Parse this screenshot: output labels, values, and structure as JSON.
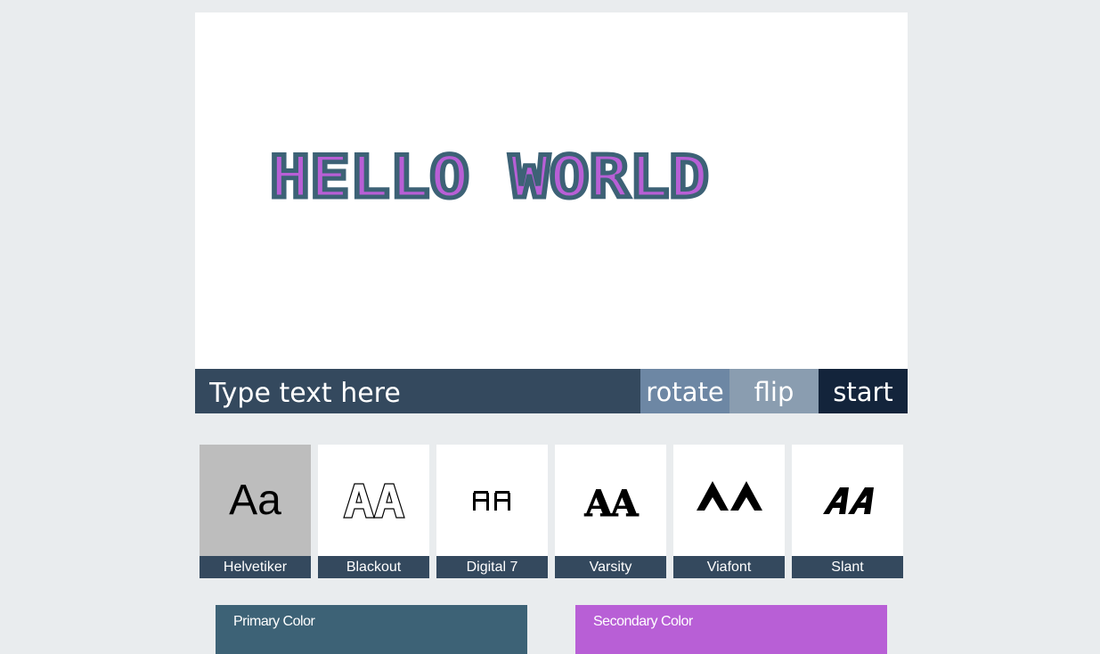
{
  "canvas": {
    "display_text": "HELLO WORLD"
  },
  "toolbar": {
    "input_placeholder": "Type text here",
    "rotate_label": "rotate",
    "flip_label": "flip",
    "start_label": "start"
  },
  "fonts": [
    {
      "label": "Helvetiker",
      "preview": "Aa",
      "icon": "helvetiker-preview-icon",
      "selected": true
    },
    {
      "label": "Blackout",
      "preview": "AA",
      "icon": "blackout-preview-icon",
      "selected": false
    },
    {
      "label": "Digital 7",
      "preview": "AA",
      "icon": "digital7-preview-icon",
      "selected": false
    },
    {
      "label": "Varsity",
      "preview": "AA",
      "icon": "varsity-preview-icon",
      "selected": false
    },
    {
      "label": "Viafont",
      "preview": "AA",
      "icon": "viafont-preview-icon",
      "selected": false
    },
    {
      "label": "Slant",
      "preview": "AA",
      "icon": "slant-preview-icon",
      "selected": false
    }
  ],
  "colors": {
    "primary_label": "Primary Color",
    "secondary_label": "Secondary Color",
    "primary": "#3d6276",
    "secondary": "#b85fd6",
    "toolbar_bg": "#34495e"
  }
}
